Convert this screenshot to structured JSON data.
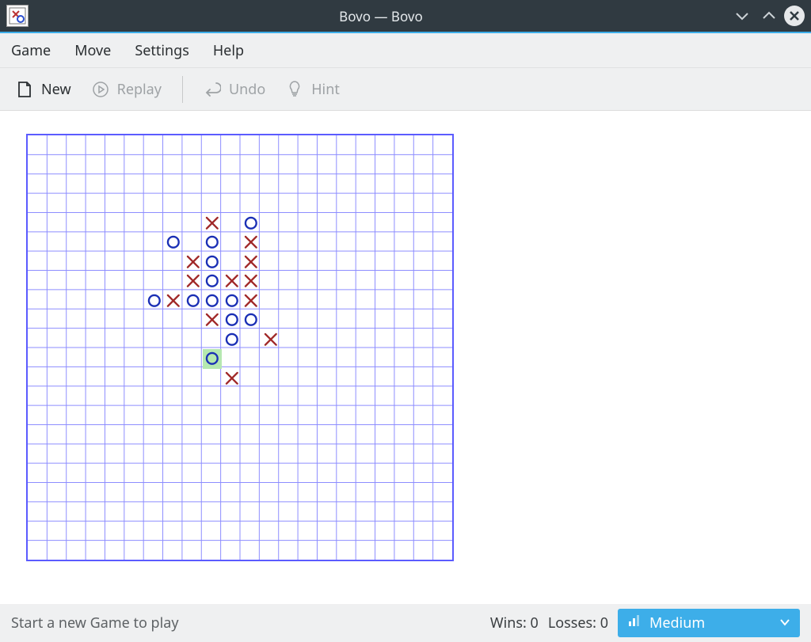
{
  "title": "Bovo — Bovo",
  "menubar": {
    "game": "Game",
    "move": "Move",
    "settings": "Settings",
    "help": "Help"
  },
  "toolbar": {
    "new": "New",
    "replay": "Replay",
    "undo": "Undo",
    "hint": "Hint"
  },
  "status": {
    "message": "Start a new Game to play",
    "wins_label": "Wins:",
    "wins_value": "0",
    "losses_label": "Losses:",
    "losses_value": "0",
    "difficulty": "Medium"
  },
  "board": {
    "cols": 22,
    "rows": 22,
    "highlight": {
      "col": 9,
      "row": 11
    },
    "moves": [
      {
        "col": 9,
        "row": 4,
        "mark": "X"
      },
      {
        "col": 11,
        "row": 4,
        "mark": "O"
      },
      {
        "col": 7,
        "row": 5,
        "mark": "O"
      },
      {
        "col": 9,
        "row": 5,
        "mark": "O"
      },
      {
        "col": 11,
        "row": 5,
        "mark": "X"
      },
      {
        "col": 8,
        "row": 6,
        "mark": "X"
      },
      {
        "col": 9,
        "row": 6,
        "mark": "O"
      },
      {
        "col": 11,
        "row": 6,
        "mark": "X"
      },
      {
        "col": 8,
        "row": 7,
        "mark": "X"
      },
      {
        "col": 9,
        "row": 7,
        "mark": "O"
      },
      {
        "col": 10,
        "row": 7,
        "mark": "X"
      },
      {
        "col": 11,
        "row": 7,
        "mark": "X"
      },
      {
        "col": 6,
        "row": 8,
        "mark": "O"
      },
      {
        "col": 7,
        "row": 8,
        "mark": "X"
      },
      {
        "col": 8,
        "row": 8,
        "mark": "O"
      },
      {
        "col": 9,
        "row": 8,
        "mark": "O"
      },
      {
        "col": 10,
        "row": 8,
        "mark": "O"
      },
      {
        "col": 11,
        "row": 8,
        "mark": "X"
      },
      {
        "col": 9,
        "row": 9,
        "mark": "X"
      },
      {
        "col": 10,
        "row": 9,
        "mark": "O"
      },
      {
        "col": 11,
        "row": 9,
        "mark": "O"
      },
      {
        "col": 10,
        "row": 10,
        "mark": "O"
      },
      {
        "col": 12,
        "row": 10,
        "mark": "X"
      },
      {
        "col": 9,
        "row": 11,
        "mark": "O"
      },
      {
        "col": 10,
        "row": 12,
        "mark": "X"
      }
    ]
  }
}
